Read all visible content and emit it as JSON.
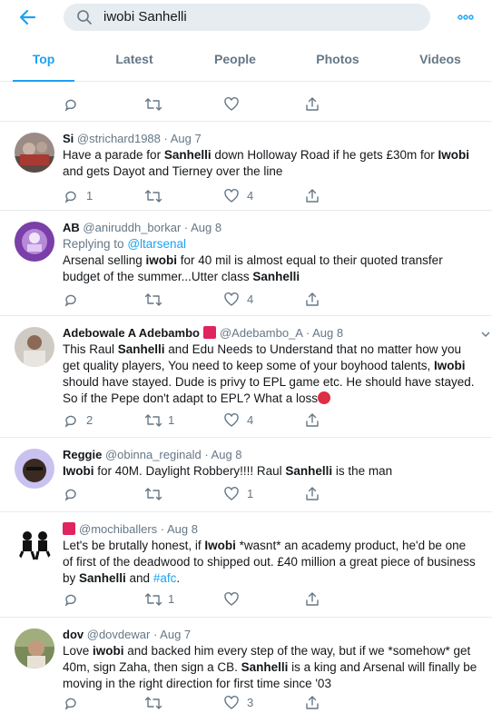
{
  "search": {
    "query": "iwobi Sanhelli"
  },
  "icons": {
    "back": "back-arrow-icon",
    "search": "search-icon",
    "more": "more-icon",
    "reply": "reply-icon",
    "retweet": "retweet-icon",
    "like": "like-icon",
    "share": "share-icon",
    "caret": "chevron-down-icon"
  },
  "colors": {
    "accent": "#1da1f2",
    "muted": "#657786",
    "border": "#e6ecf0"
  },
  "tabs": [
    {
      "label": "Top"
    },
    {
      "label": "Latest"
    },
    {
      "label": "People"
    },
    {
      "label": "Photos"
    },
    {
      "label": "Videos"
    }
  ],
  "tweets": [
    {
      "name": "Si",
      "handle": "@strichard1988",
      "date": "Aug 7",
      "text_html": "Have a parade for <b>Sanhelli</b> down Holloway Road if he gets £30m for <b>Iwobi</b> and gets Dayot and Tierney over the line",
      "replies": "1",
      "retweets": "",
      "likes": "4"
    },
    {
      "name": "AB",
      "handle": "@aniruddh_borkar",
      "date": "Aug 8",
      "reply_prefix": "Replying to",
      "reply_to": "@ltarsenal",
      "text_html": "Arsenal selling <b>iwobi</b> for 40 mil is almost equal to their quoted transfer budget of the summer...Utter class <b>Sanhelli</b>",
      "replies": "",
      "retweets": "",
      "likes": "4"
    },
    {
      "name": "Adebowale A Adebambo",
      "handle": "@Adebambo_A",
      "date": "Aug 8",
      "text_html": "This Raul <b>Sanhelli</b> and Edu Needs to Understand that no matter how you get quality players, You need to keep some of your boyhood talents, <b>Iwobi</b> should have stayed. Dude is privy to EPL game etc. He should have stayed. So if the Pepe don't adapt to EPL? What a loss",
      "replies": "2",
      "retweets": "1",
      "likes": "4"
    },
    {
      "name": "Reggie",
      "handle": "@obinna_reginald",
      "date": "Aug 8",
      "text_html": "<b>Iwobi</b> for 40M. Daylight Robbery!!!! Raul <b>Sanhelli</b> is the man",
      "replies": "",
      "retweets": "",
      "likes": "1"
    },
    {
      "name": "",
      "handle": "@mochiballers",
      "date": "Aug 8",
      "text_html": "Let's be brutally honest, if <b>Iwobi</b> *wasnt* an academy product, he'd be one of first of the deadwood to shipped out. £40 million a great piece of business by <b>Sanhelli</b> and <span class=\"link\">#afc</span>.",
      "replies": "",
      "retweets": "1",
      "likes": ""
    },
    {
      "name": "dov",
      "handle": "@dovdewar",
      "date": "Aug 7",
      "text_html": "Love <b>iwobi</b> and backed him every step of the way, but if we *somehow* get 40m, sign Zaha, then sign a CB.  <b>Sanhelli</b> is a king and Arsenal will finally be moving in the right direction for first time since '03",
      "replies": "",
      "retweets": "",
      "likes": "3"
    }
  ]
}
